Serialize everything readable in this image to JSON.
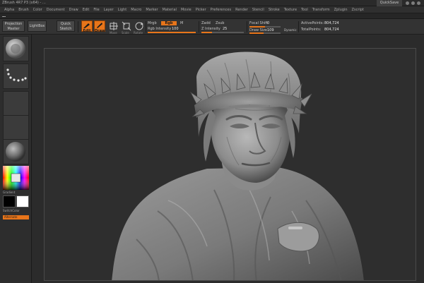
{
  "titlebar": {
    "title": "ZBrush 4R7 P3 (x64) - …",
    "quicksave_label": "QuickSave"
  },
  "menu": [
    "Alpha",
    "Brush",
    "Color",
    "Document",
    "Draw",
    "Edit",
    "File",
    "Layer",
    "Light",
    "Macro",
    "Marker",
    "Material",
    "Movie",
    "Picker",
    "Preferences",
    "Render",
    "Stencil",
    "Stroke",
    "Texture",
    "Tool",
    "Transform",
    "Zplugin",
    "Zscript"
  ],
  "infobar": {
    "message": "…"
  },
  "toolbar": {
    "projection_master": "Projection Master",
    "lightbox": "LightBox",
    "quick_sketch": "Quick Sketch",
    "edit": "Edit",
    "draw": "Draw",
    "move": "Move",
    "scale": "Scale",
    "rotate": "Rotate",
    "mrgb": "Mrgb",
    "rgb": "Rgb",
    "m": "M",
    "rgb_intensity_label": "Rgb Intensity",
    "rgb_intensity_value": "100",
    "zadd": "Zadd",
    "zsub": "Zsub",
    "z_intensity_label": "Z Intensity",
    "z_intensity_value": "25",
    "z_intensity_pct": 0.25,
    "focal_shift_label": "Focal Shift",
    "focal_shift_value": "0",
    "draw_size_label": "Draw Size",
    "draw_size_value": "109",
    "dynamic": "Dynamic",
    "active_points_label": "ActivePoints:",
    "active_points_value": "804,724",
    "total_points_label": "TotalPoints:",
    "total_points_value": "804,724"
  },
  "leftbar": {
    "gradient_label": "Gradient",
    "switch_color_label": "SwitchColor",
    "alternate_label": "Alternate"
  },
  "colors": {
    "accent": "#e8751a",
    "panel": "#333333",
    "background": "#2b2b2b"
  }
}
